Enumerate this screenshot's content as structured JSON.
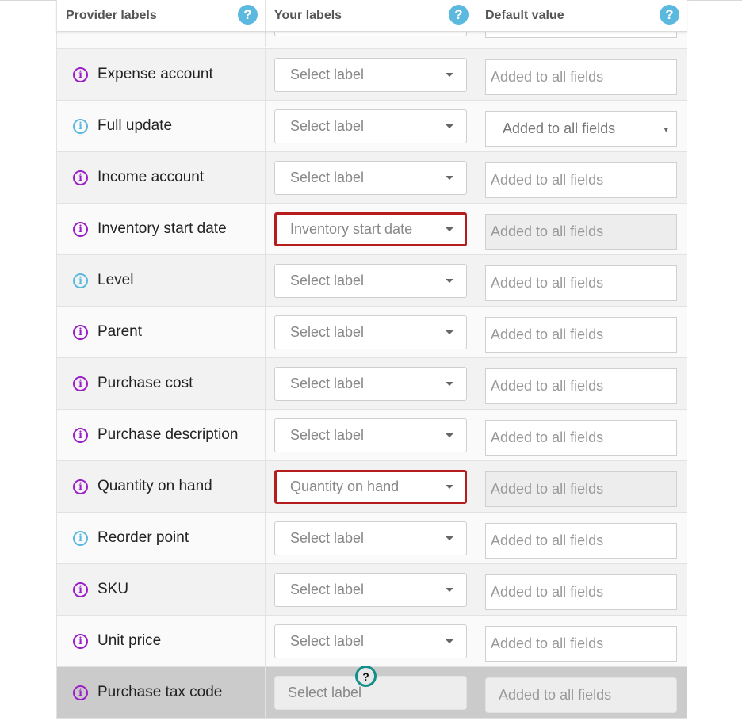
{
  "header": {
    "columns": [
      {
        "label": "Provider labels",
        "help_icon": "question-circle-icon"
      },
      {
        "label": "Your labels",
        "help_icon": "question-circle-icon"
      },
      {
        "label": "Default value",
        "help_icon": "question-circle-icon"
      }
    ]
  },
  "colors": {
    "required_info": "#9b1fc9",
    "optional_info": "#5bb8df",
    "highlight_border": "#b71c1c",
    "help_icon": "#5bb8df"
  },
  "rows": [
    {
      "provider_label": "Expense account",
      "info_type": "purple",
      "your_label": "Select label",
      "default_value_placeholder": "Added to all fields",
      "default_type": "input"
    },
    {
      "provider_label": "Full update",
      "info_type": "blue",
      "your_label": "Select label",
      "default_value_placeholder": "Added to all fields",
      "default_type": "select"
    },
    {
      "provider_label": "Income account",
      "info_type": "purple",
      "your_label": "Select label",
      "default_value_placeholder": "Added to all fields",
      "default_type": "input"
    },
    {
      "provider_label": "Inventory start date",
      "info_type": "purple",
      "your_label": "Inventory start date",
      "highlighted": true,
      "default_value_placeholder": "Added to all fields",
      "default_type": "readonly"
    },
    {
      "provider_label": "Level",
      "info_type": "blue",
      "your_label": "Select label",
      "default_value_placeholder": "Added to all fields",
      "default_type": "input"
    },
    {
      "provider_label": "Parent",
      "info_type": "purple",
      "your_label": "Select label",
      "default_value_placeholder": "Added to all fields",
      "default_type": "input"
    },
    {
      "provider_label": "Purchase cost",
      "info_type": "purple",
      "your_label": "Select label",
      "default_value_placeholder": "Added to all fields",
      "default_type": "input"
    },
    {
      "provider_label": "Purchase description",
      "info_type": "purple",
      "your_label": "Select label",
      "default_value_placeholder": "Added to all fields",
      "default_type": "input"
    },
    {
      "provider_label": "Quantity on hand",
      "info_type": "purple",
      "your_label": "Quantity on hand",
      "highlighted": true,
      "default_value_placeholder": "Added to all fields",
      "default_type": "readonly"
    },
    {
      "provider_label": "Reorder point",
      "info_type": "blue",
      "your_label": "Select label",
      "default_value_placeholder": "Added to all fields",
      "default_type": "input"
    },
    {
      "provider_label": "SKU",
      "info_type": "purple",
      "your_label": "Select label",
      "default_value_placeholder": "Added to all fields",
      "default_type": "input"
    },
    {
      "provider_label": "Unit price",
      "info_type": "purple",
      "your_label": "Select label",
      "default_value_placeholder": "Added to all fields",
      "default_type": "input"
    },
    {
      "provider_label": "Purchase tax code",
      "info_type": "purple",
      "your_label": "Select label",
      "disabled": true,
      "default_value_placeholder": "Added to all fields",
      "default_type": "disabled",
      "tooltip_icon": "question-circle-icon"
    }
  ],
  "info_glyph": "i",
  "help_glyph": "?",
  "select_caret": "▾"
}
